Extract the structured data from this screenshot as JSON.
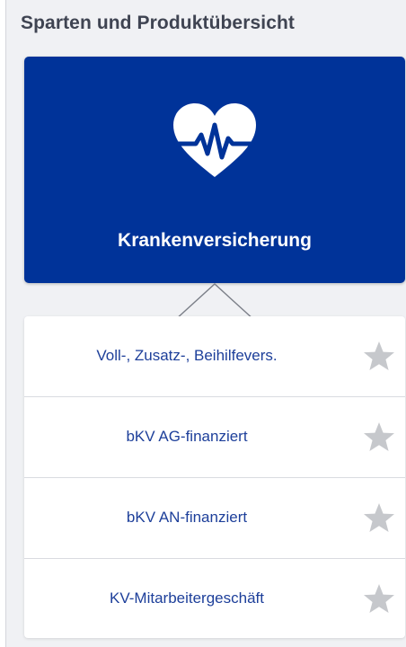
{
  "header": {
    "title": "Sparten und Produktübersicht"
  },
  "category": {
    "label": "Krankenversicherung",
    "icon": "heart-pulse-icon",
    "background_color": "#003399"
  },
  "products": [
    {
      "label": "Voll-, Zusatz-, Beihilfevers.",
      "favorite_icon": "star-icon"
    },
    {
      "label": "bKV AG-finanziert",
      "favorite_icon": "star-icon"
    },
    {
      "label": "bKV AN-finanziert",
      "favorite_icon": "star-icon"
    },
    {
      "label": "KV-Mitarbeitergeschäft",
      "favorite_icon": "star-icon"
    }
  ],
  "colors": {
    "accent": "#003399",
    "link_text": "#1d3f9a",
    "star": "#c6c8cc"
  }
}
